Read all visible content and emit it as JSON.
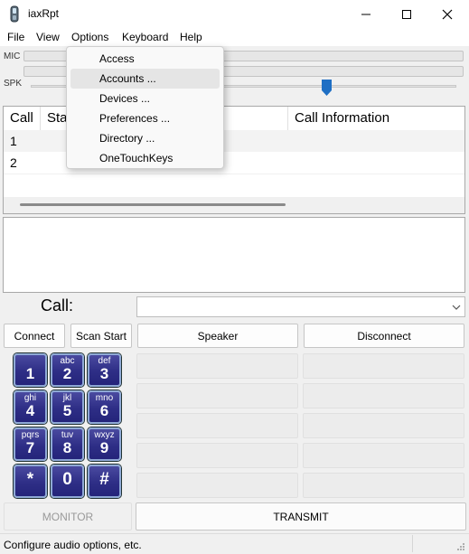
{
  "window": {
    "title": "iaxRpt"
  },
  "menu": [
    "File",
    "View",
    "Options",
    "Keyboard",
    "Help"
  ],
  "options_menu": [
    "Access",
    "Accounts ...",
    "Devices ...",
    "Preferences ...",
    "Directory ...",
    "OneTouchKeys"
  ],
  "meters": {
    "mic_label": "MIC",
    "spk_label": "SPK"
  },
  "call_list": {
    "columns": [
      "Call",
      "Sta",
      "Call Information"
    ],
    "rows": [
      "1",
      "2"
    ]
  },
  "call_input": {
    "label": "Call:",
    "value": ""
  },
  "buttons": {
    "connect": "Connect",
    "scan_start": "Scan Start",
    "speaker": "Speaker",
    "disconnect": "Disconnect",
    "monitor": "MONITOR",
    "transmit": "TRANSMIT"
  },
  "keypad": [
    {
      "main": "1",
      "sub": ""
    },
    {
      "main": "2",
      "sub": "abc"
    },
    {
      "main": "3",
      "sub": "def"
    },
    {
      "main": "4",
      "sub": "ghi"
    },
    {
      "main": "5",
      "sub": "jkl"
    },
    {
      "main": "6",
      "sub": "mno"
    },
    {
      "main": "7",
      "sub": "pqrs"
    },
    {
      "main": "8",
      "sub": "tuv"
    },
    {
      "main": "9",
      "sub": "wxyz"
    },
    {
      "main": "*",
      "sub": ""
    },
    {
      "main": "0",
      "sub": ""
    },
    {
      "main": "#",
      "sub": ""
    }
  ],
  "status": {
    "text": "Configure audio options, etc."
  },
  "colors": {
    "key_fill": "#2e2e86",
    "key_border": "#8fa9d6",
    "slider_thumb": "#1f6fc4",
    "menu_highlight": "#e5e5e5"
  }
}
